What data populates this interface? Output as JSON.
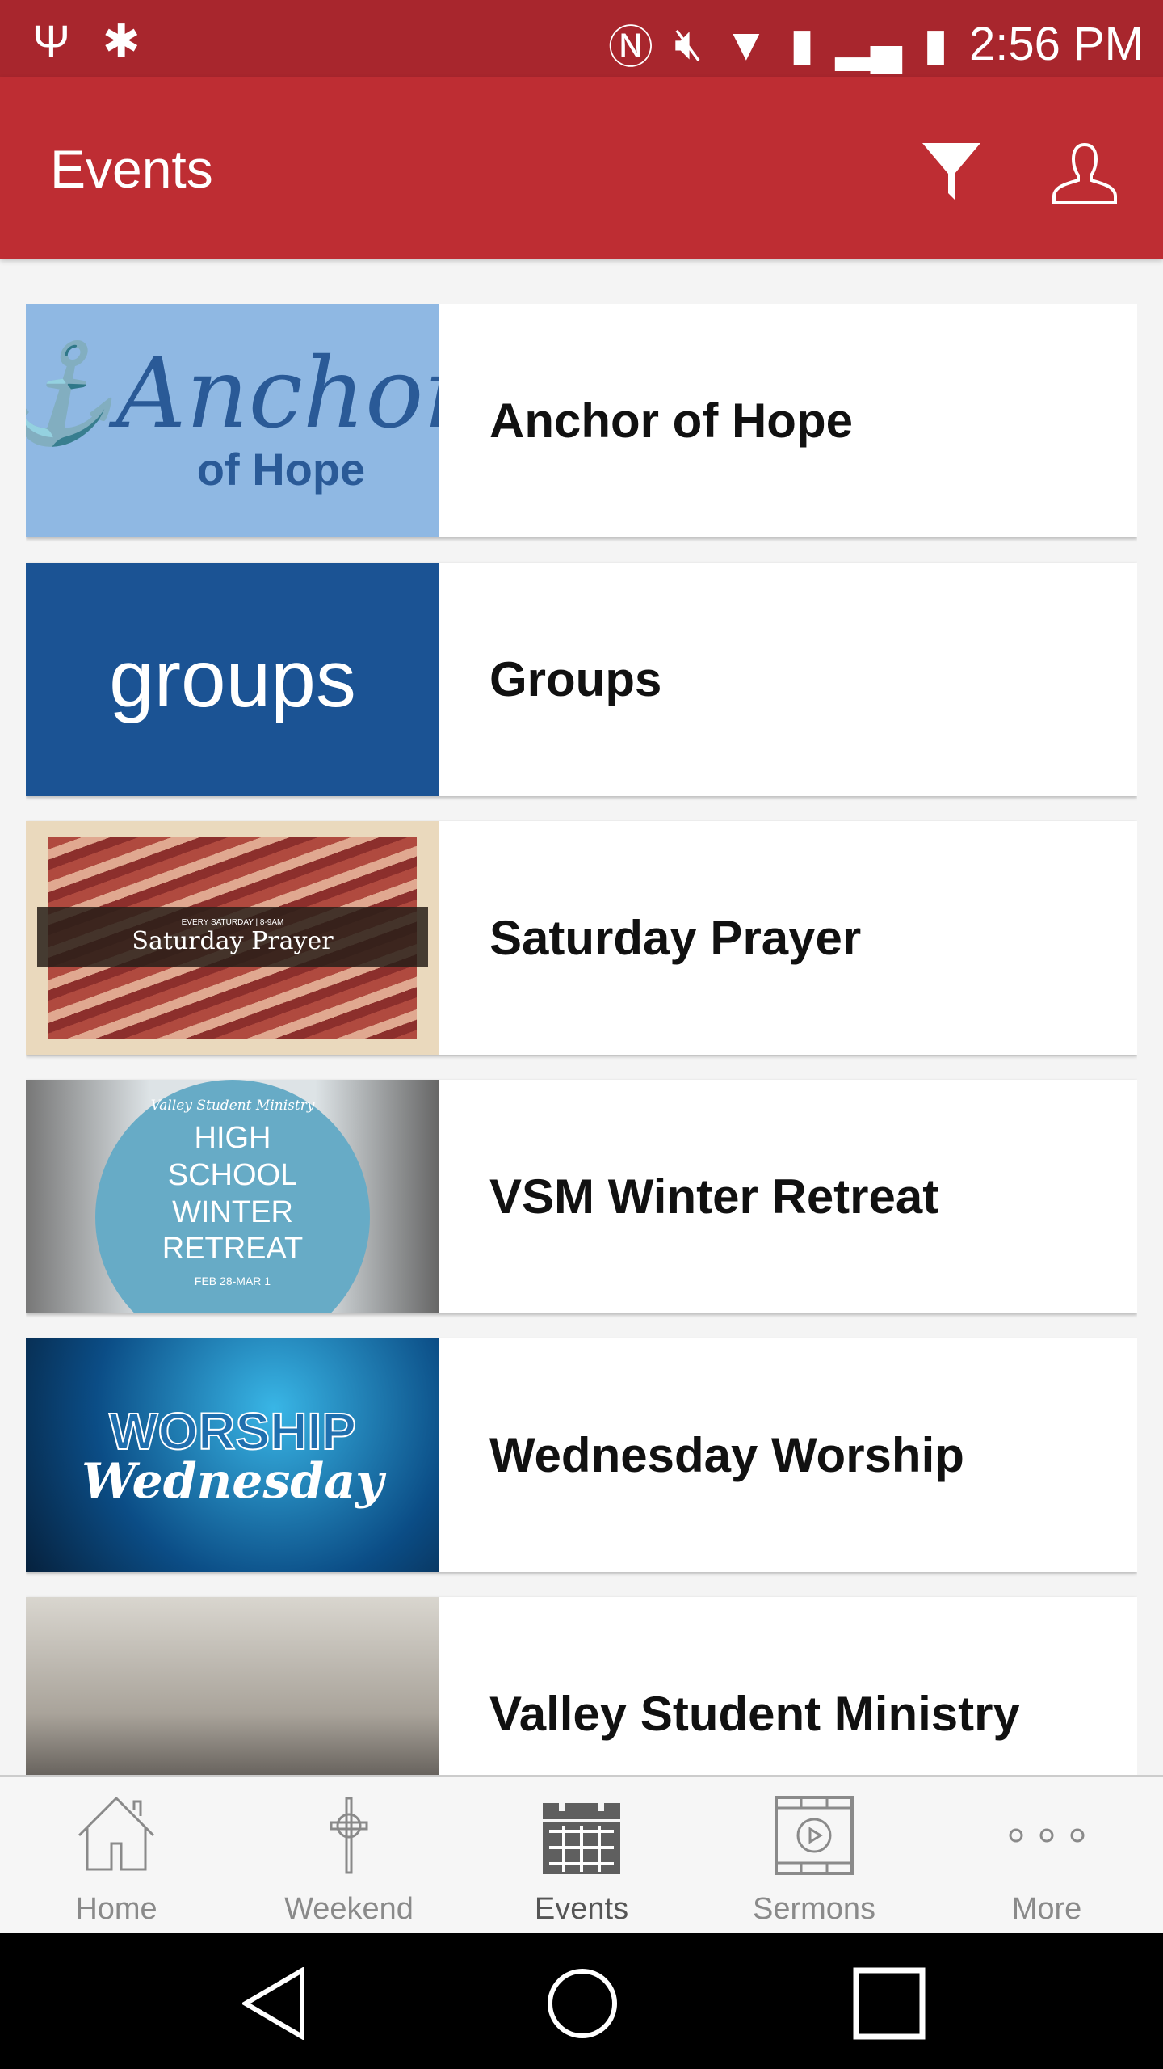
{
  "status_bar": {
    "time": "2:56 PM",
    "icons": [
      "usb-icon",
      "android-debug-icon",
      "nfc-icon",
      "mute-icon",
      "wifi-icon",
      "no-sim-icon",
      "signal-icon",
      "battery-charging-icon"
    ]
  },
  "app_bar": {
    "title": "Events",
    "actions": [
      "filter-icon",
      "user-icon"
    ]
  },
  "accent_color": "#be2d33",
  "events": [
    {
      "title": "Anchor of Hope",
      "image_text": "Anchor",
      "image_subtext": "of Hope"
    },
    {
      "title": "Groups",
      "image_text": "groups"
    },
    {
      "title": "Saturday Prayer",
      "image_small": "EVERY SATURDAY | 8-9AM",
      "image_text": "Saturday Prayer"
    },
    {
      "title": "VSM Winter Retreat",
      "image_small": "Valley Student Ministry",
      "image_text": "HIGH SCHOOL WINTER RETREAT",
      "image_subtext": "FEB 28-MAR 1"
    },
    {
      "title": "Wednesday Worship",
      "image_text": "WORSHIP",
      "image_subtext": "Wednesday"
    },
    {
      "title": "Valley Student Ministry"
    }
  ],
  "bottom_nav": {
    "active": "Events",
    "items": [
      {
        "label": "Home",
        "icon": "home-icon"
      },
      {
        "label": "Weekend",
        "icon": "cross-icon"
      },
      {
        "label": "Events",
        "icon": "calendar-icon"
      },
      {
        "label": "Sermons",
        "icon": "video-icon"
      },
      {
        "label": "More",
        "icon": "more-icon"
      }
    ]
  },
  "system_nav": [
    "back-icon",
    "home-circle-icon",
    "recents-icon"
  ]
}
